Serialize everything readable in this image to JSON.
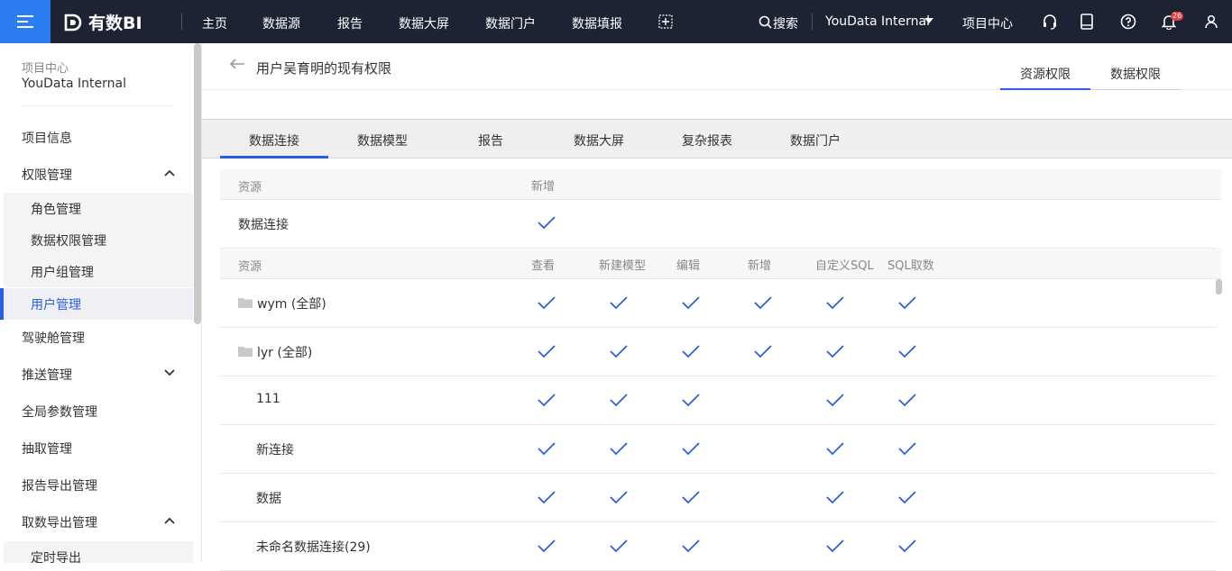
{
  "app": {
    "logo": "有数BI"
  },
  "topnav": {
    "items": [
      "主页",
      "数据源",
      "报告",
      "数据大屏",
      "数据门户",
      "数据填报"
    ],
    "search": "搜索",
    "project": "YouData Internal",
    "project_center": "项目中心",
    "notification_count": "26"
  },
  "sidebar": {
    "project_label": "项目中心",
    "project_name": "YouData Internal",
    "items": {
      "project_info": "项目信息",
      "perm_mgmt": "权限管理",
      "role_mgmt": "角色管理",
      "data_perm_mgmt": "数据权限管理",
      "user_group_mgmt": "用户组管理",
      "user_mgmt": "用户管理",
      "cockpit_mgmt": "驾驶舱管理",
      "push_mgmt": "推送管理",
      "global_param_mgmt": "全局参数管理",
      "extract_mgmt": "抽取管理",
      "report_export_mgmt": "报告导出管理",
      "data_export_mgmt": "取数导出管理",
      "scheduled_export": "定时导出"
    }
  },
  "page": {
    "title": "用户吴育明的现有权限",
    "top_tabs": [
      "资源权限",
      "数据权限"
    ],
    "active_top_tab": 0
  },
  "tabs": {
    "items": [
      "数据连接",
      "数据模型",
      "报告",
      "数据大屏",
      "复杂报表",
      "数据门户"
    ],
    "active": 0
  },
  "table1": {
    "headers": [
      "资源",
      "新增"
    ],
    "rows": [
      {
        "name": "数据连接",
        "checks": [
          true
        ]
      }
    ]
  },
  "table2": {
    "headers": [
      "资源",
      "查看",
      "新建模型",
      "编辑",
      "新增",
      "自定义SQL",
      "SQL取数"
    ],
    "rows": [
      {
        "name": "wym  (全部)",
        "folder": true,
        "checks": [
          true,
          true,
          true,
          true,
          true,
          true
        ]
      },
      {
        "name": "lyr  (全部)",
        "folder": true,
        "checks": [
          true,
          true,
          true,
          true,
          true,
          true
        ]
      },
      {
        "name": "111",
        "folder": false,
        "checks": [
          true,
          true,
          true,
          false,
          true,
          true
        ]
      },
      {
        "name": "新连接",
        "folder": false,
        "checks": [
          true,
          true,
          true,
          false,
          true,
          true
        ]
      },
      {
        "name": "数据",
        "folder": false,
        "checks": [
          true,
          true,
          true,
          false,
          true,
          true
        ]
      },
      {
        "name": "未命名数据连接(29)",
        "folder": false,
        "checks": [
          true,
          true,
          true,
          false,
          true,
          true
        ]
      }
    ]
  },
  "colors": {
    "accent": "#2b5ce6",
    "topbar": "#1c2434",
    "menu_btn": "#2b7df0"
  },
  "icons": [
    "menu-icon",
    "logo-icon",
    "add-icon",
    "search-icon",
    "caret-down-icon",
    "headset-icon",
    "book-icon",
    "help-icon",
    "bell-icon",
    "user-icon",
    "back-arrow-icon",
    "folder-icon",
    "check-icon",
    "chevron-up-icon",
    "chevron-down-icon"
  ]
}
